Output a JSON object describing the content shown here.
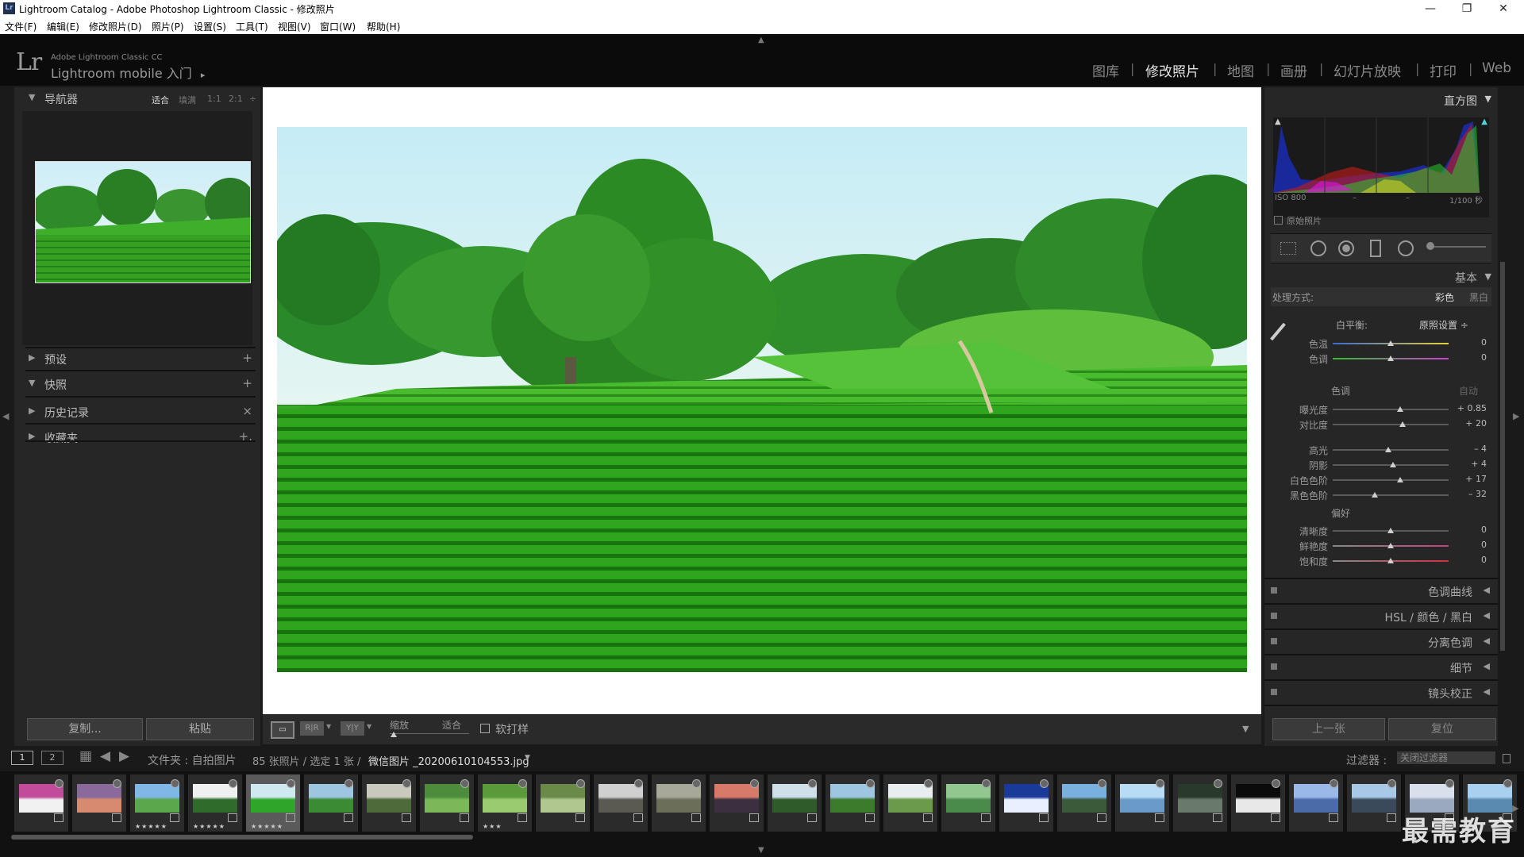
{
  "window": {
    "title": "Lightroom Catalog - Adobe Photoshop Lightroom Classic - 修改照片",
    "icon_label": "Lr",
    "controls": [
      "—",
      "❐",
      "✕"
    ]
  },
  "menu": [
    "文件(F)",
    "编辑(E)",
    "修改照片(D)",
    "照片(P)",
    "设置(S)",
    "工具(T)",
    "视图(V)",
    "窗口(W)",
    "帮助(H)"
  ],
  "header": {
    "logo": "Lr",
    "product": "Adobe Lightroom Classic CC",
    "mobile": "Lightroom mobile 入门",
    "mobile_arrow": "▸",
    "modules": [
      "图库",
      "修改照片",
      "地图",
      "画册",
      "幻灯片放映",
      "打印",
      "Web"
    ],
    "active_module": "修改照片"
  },
  "left_panel": {
    "navigator": {
      "title": "导航器",
      "zoom_options": [
        "适合",
        "填满",
        "1:1",
        "2:1"
      ],
      "zoom_active": "适合",
      "zoom_more": "÷"
    },
    "sections": [
      {
        "label": "预设",
        "action": "+"
      },
      {
        "label": "快照",
        "action": "+"
      },
      {
        "label": "历史记录",
        "action": "×"
      },
      {
        "label": "收藏夹",
        "action": "+."
      }
    ],
    "copy_button": "复制...",
    "paste_button": "粘贴"
  },
  "toolbar": {
    "view_modes": [
      "▭",
      "R|R",
      "Y|Y"
    ],
    "zoom_label": "缩放",
    "zoom_value": "适合",
    "soft_proof_label": "软打样",
    "expand_arrow": "▼"
  },
  "right_panel": {
    "histogram": {
      "title": "直方图",
      "iso": "ISO 800",
      "dash1": "–",
      "dash2": "–",
      "shutter": "1/100 秒",
      "original_photo_label": "原始照片"
    },
    "basic": {
      "title": "基本",
      "treatment_label": "处理方式:",
      "treatment_color": "彩色",
      "treatment_bw": "黑白",
      "wb_label": "白平衡:",
      "wb_value": "原照设置 ÷",
      "wb_sliders": [
        {
          "name": "色温",
          "value": "0",
          "pos": 0.5
        },
        {
          "name": "色调",
          "value": "0",
          "pos": 0.5
        }
      ],
      "tone_label": "色调",
      "tone_auto": "自动",
      "tone_sliders": [
        {
          "name": "曝光度",
          "value": "+ 0.85",
          "pos": 0.58
        },
        {
          "name": "对比度",
          "value": "+ 20",
          "pos": 0.6
        }
      ],
      "tone_sliders2": [
        {
          "name": "高光",
          "value": "– 4",
          "pos": 0.48
        },
        {
          "name": "阴影",
          "value": "+ 4",
          "pos": 0.52
        },
        {
          "name": "白色色阶",
          "value": "+ 17",
          "pos": 0.58
        },
        {
          "name": "黑色色阶",
          "value": "– 32",
          "pos": 0.36
        }
      ],
      "presence_label": "偏好",
      "presence_sliders": [
        {
          "name": "清晰度",
          "value": "0",
          "pos": 0.5
        },
        {
          "name": "鲜艳度",
          "value": "0",
          "pos": 0.5
        },
        {
          "name": "饱和度",
          "value": "0",
          "pos": 0.5
        }
      ]
    },
    "collapsed_sections": [
      "色调曲线",
      "HSL / 颜色 / 黑白",
      "分离色调",
      "细节",
      "镜头校正"
    ],
    "prev_button": "上一张",
    "reset_button": "复位"
  },
  "filmstrip_bar": {
    "page1": "1",
    "page2": "2",
    "source": "文件夹 : 自拍图片",
    "count": "85 张照片 / 选定 1 张 /",
    "filename": "微信图片 _20200610104553.jpg",
    "filter_label": "过滤器 :",
    "filter_value": "关闭过滤器"
  },
  "filmstrip": [
    {
      "stars": "",
      "colors": [
        "#c24b9c",
        "#f1f1f1"
      ]
    },
    {
      "stars": "",
      "colors": [
        "#8a6a9a",
        "#d88a70"
      ]
    },
    {
      "stars": "★★★★★",
      "colors": [
        "#7fb7e6",
        "#59a84b"
      ]
    },
    {
      "stars": "★★★★★",
      "colors": [
        "#f0f0f0",
        "#2f6b2a"
      ]
    },
    {
      "stars": "★★★★★",
      "colors": [
        "#cfe9f0",
        "#2fa62a"
      ]
    },
    {
      "stars": "",
      "colors": [
        "#9fc6e0",
        "#3b8a34"
      ]
    },
    {
      "stars": "",
      "colors": [
        "#c9c9bd",
        "#4e6a3a"
      ]
    },
    {
      "stars": "",
      "colors": [
        "#4d8c3a",
        "#7ab85a"
      ]
    },
    {
      "stars": "★★★",
      "colors": [
        "#5a9a3a",
        "#9acb70"
      ]
    },
    {
      "stars": "",
      "colors": [
        "#6a8a4a",
        "#b0c890"
      ]
    },
    {
      "stars": "",
      "colors": [
        "#d0d0d0",
        "#5a5a52"
      ]
    },
    {
      "stars": "",
      "colors": [
        "#a8a89a",
        "#6b6f5a"
      ]
    },
    {
      "stars": "",
      "colors": [
        "#d87a6a",
        "#3a3040"
      ]
    },
    {
      "stars": "",
      "colors": [
        "#cfe0ea",
        "#2f5a2a"
      ]
    },
    {
      "stars": "",
      "colors": [
        "#9ec6e0",
        "#3c7a2c"
      ]
    },
    {
      "stars": "",
      "colors": [
        "#e8eef0",
        "#6a9a4a"
      ]
    },
    {
      "stars": "",
      "colors": [
        "#90c890",
        "#4a8a4a"
      ]
    },
    {
      "stars": "",
      "colors": [
        "#1a3a9a",
        "#e8f0ff"
      ]
    },
    {
      "stars": "",
      "colors": [
        "#7ab0e0",
        "#3a5a3a"
      ]
    },
    {
      "stars": "",
      "colors": [
        "#b8dcf4",
        "#6a9ac8"
      ]
    },
    {
      "stars": "",
      "colors": [
        "#2a3a2a",
        "#6a7a6a"
      ]
    },
    {
      "stars": "",
      "colors": [
        "#0a0a0a",
        "#e8e8e8"
      ]
    },
    {
      "stars": "",
      "colors": [
        "#9ab8e8",
        "#4a6aa8"
      ]
    },
    {
      "stars": "",
      "colors": [
        "#a8c8e8",
        "#3a4a5a"
      ]
    },
    {
      "stars": "",
      "colors": [
        "#d8e0ec",
        "#9aa8c0"
      ]
    },
    {
      "stars": "",
      "colors": [
        "#a8d0f0",
        "#5a8ab0"
      ]
    }
  ],
  "watermark": "最需教育"
}
